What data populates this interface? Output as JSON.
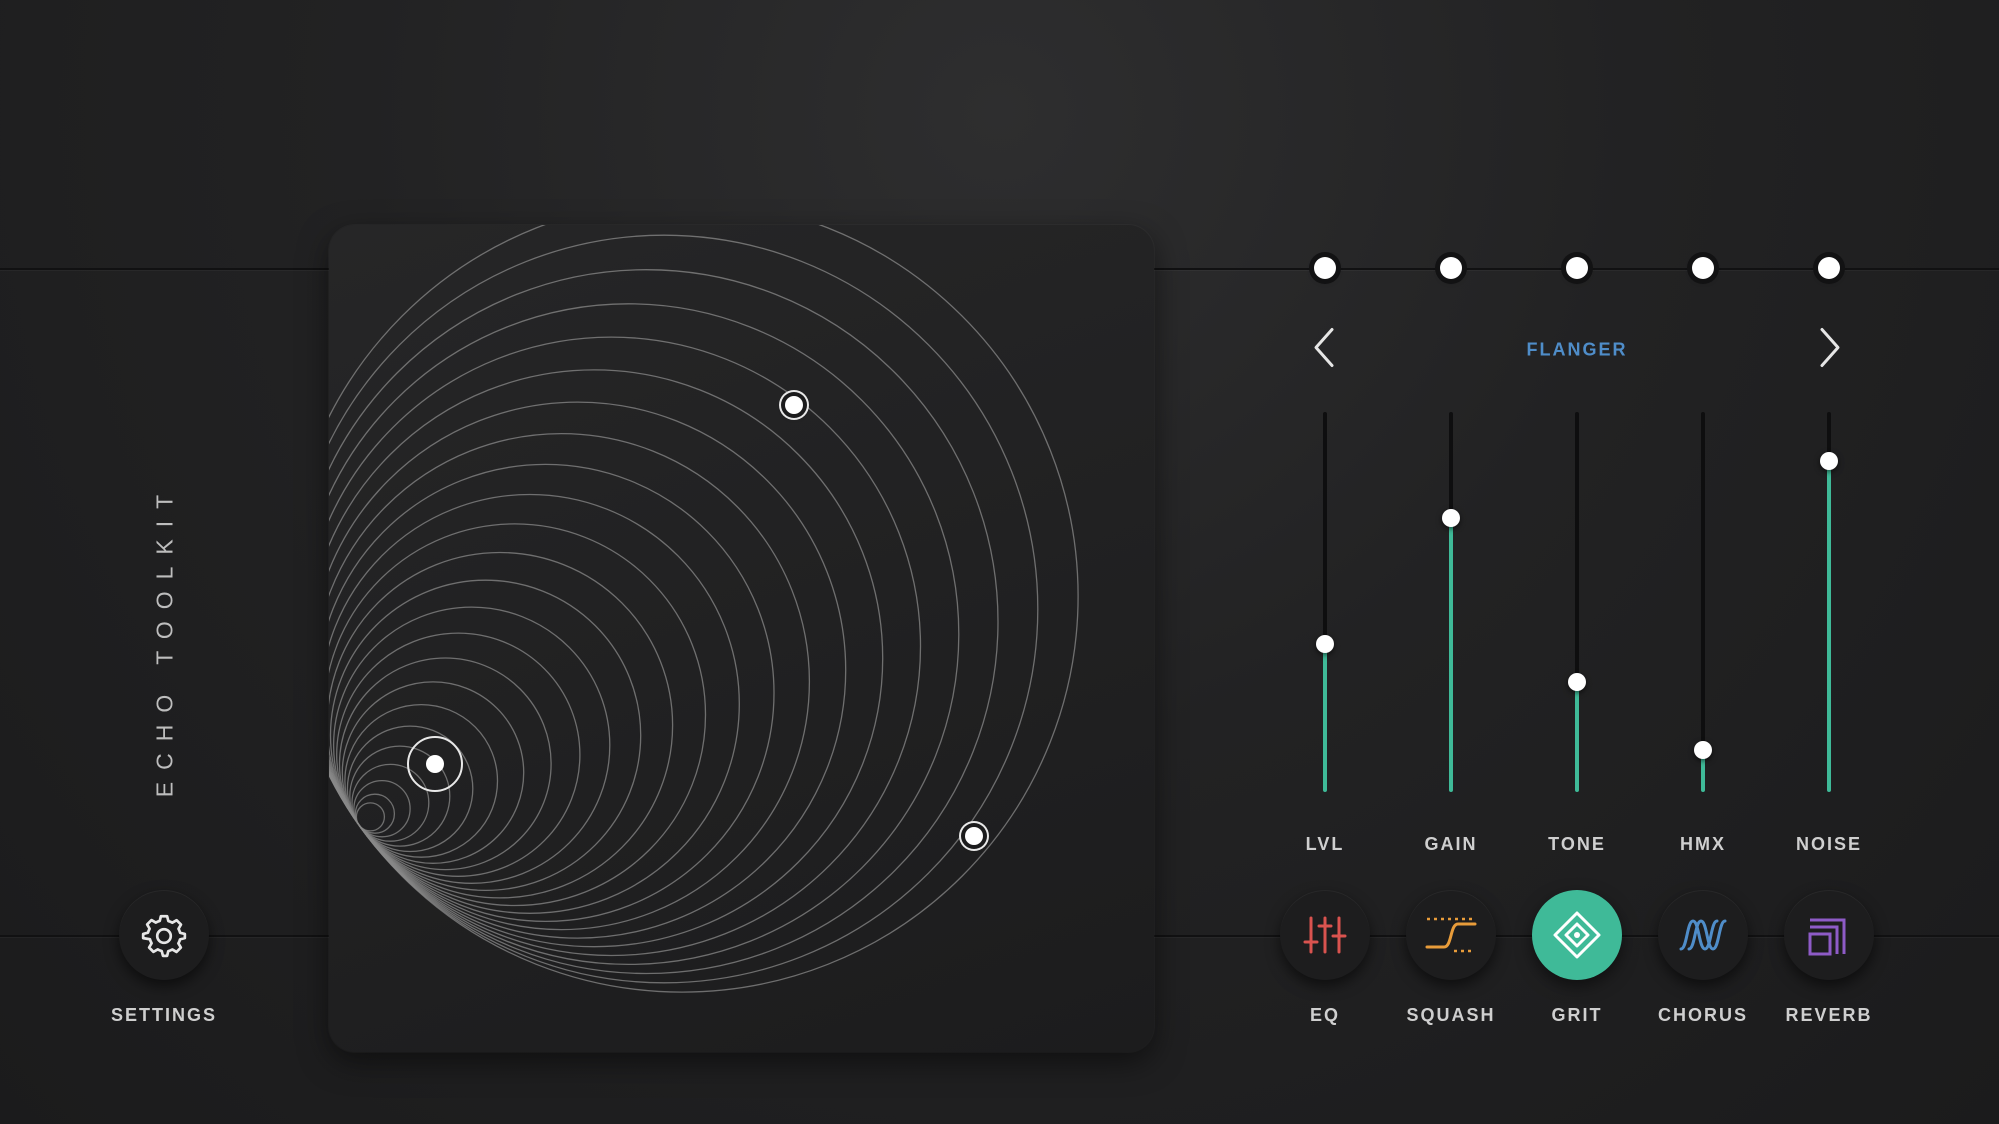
{
  "app": {
    "title": "ECHO TOOLKIT"
  },
  "settings": {
    "label": "SETTINGS",
    "icon": "gear-icon"
  },
  "xy_pad": {
    "nodes": [
      {
        "name": "node-top",
        "style": "ring"
      },
      {
        "name": "node-left",
        "style": "ring-large"
      },
      {
        "name": "node-right",
        "style": "ring"
      }
    ]
  },
  "preset": {
    "name": "FLANGER"
  },
  "sliders": [
    {
      "label": "LVL",
      "value": 0.39
    },
    {
      "label": "GAIN",
      "value": 0.72
    },
    {
      "label": "TONE",
      "value": 0.29
    },
    {
      "label": "HMX",
      "value": 0.11
    },
    {
      "label": "NOISE",
      "value": 0.87
    }
  ],
  "modules": [
    {
      "label": "EQ",
      "icon": "eq-sliders-icon",
      "color": "#d9534f",
      "active": false
    },
    {
      "label": "SQUASH",
      "icon": "compressor-curve-icon",
      "color": "#e89c3a",
      "active": false
    },
    {
      "label": "GRIT",
      "icon": "diamond-icon",
      "color": "#ffffff",
      "active": true
    },
    {
      "label": "CHORUS",
      "icon": "chorus-wave-icon",
      "color": "#4f8dc9",
      "active": false
    },
    {
      "label": "REVERB",
      "icon": "reverb-squares-icon",
      "color": "#8e5bc7",
      "active": false
    }
  ],
  "colors": {
    "accent": "#3fba98",
    "preset_text": "#4f8dc9"
  }
}
